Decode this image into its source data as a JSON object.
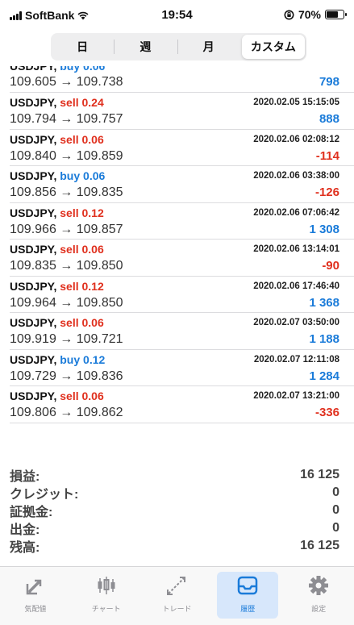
{
  "status": {
    "carrier": "SoftBank",
    "time": "19:54",
    "battery": "70%",
    "battery_level": 0.7
  },
  "periods": [
    {
      "label": "日",
      "active": false
    },
    {
      "label": "週",
      "active": false
    },
    {
      "label": "月",
      "active": false
    },
    {
      "label": "カスタム",
      "active": true
    }
  ],
  "deals": [
    {
      "symbol": "USDJPY,",
      "side": "buy",
      "volume": "0.06",
      "time": "",
      "prices": "109.605 → 109.738",
      "profit": "798",
      "partial": true
    },
    {
      "symbol": "USDJPY,",
      "side": "sell",
      "volume": "0.24",
      "time": "2020.02.05 15:15:05",
      "prices": "109.794 → 109.757",
      "profit": "888"
    },
    {
      "symbol": "USDJPY,",
      "side": "sell",
      "volume": "0.06",
      "time": "2020.02.06 02:08:12",
      "prices": "109.840 → 109.859",
      "profit": "-114"
    },
    {
      "symbol": "USDJPY,",
      "side": "buy",
      "volume": "0.06",
      "time": "2020.02.06 03:38:00",
      "prices": "109.856 → 109.835",
      "profit": "-126"
    },
    {
      "symbol": "USDJPY,",
      "side": "sell",
      "volume": "0.12",
      "time": "2020.02.06 07:06:42",
      "prices": "109.966 → 109.857",
      "profit": "1 308"
    },
    {
      "symbol": "USDJPY,",
      "side": "sell",
      "volume": "0.06",
      "time": "2020.02.06 13:14:01",
      "prices": "109.835 → 109.850",
      "profit": "-90"
    },
    {
      "symbol": "USDJPY,",
      "side": "sell",
      "volume": "0.12",
      "time": "2020.02.06 17:46:40",
      "prices": "109.964 → 109.850",
      "profit": "1 368"
    },
    {
      "symbol": "USDJPY,",
      "side": "sell",
      "volume": "0.06",
      "time": "2020.02.07 03:50:00",
      "prices": "109.919 → 109.721",
      "profit": "1 188"
    },
    {
      "symbol": "USDJPY,",
      "side": "buy",
      "volume": "0.12",
      "time": "2020.02.07 12:11:08",
      "prices": "109.729 → 109.836",
      "profit": "1 284"
    },
    {
      "symbol": "USDJPY,",
      "side": "sell",
      "volume": "0.06",
      "time": "2020.02.07 13:21:00",
      "prices": "109.806 → 109.862",
      "profit": "-336"
    }
  ],
  "summary": [
    {
      "label": "損益:",
      "value": "16 125"
    },
    {
      "label": "クレジット:",
      "value": "0"
    },
    {
      "label": "証拠金:",
      "value": "0"
    },
    {
      "label": "出金:",
      "value": "0"
    },
    {
      "label": "残高:",
      "value": "16 125"
    }
  ],
  "tabs": [
    {
      "label": "気配値",
      "icon": "quotes-icon",
      "active": false
    },
    {
      "label": "チャート",
      "icon": "chart-icon",
      "active": false
    },
    {
      "label": "トレード",
      "icon": "trade-icon",
      "active": false
    },
    {
      "label": "履歴",
      "icon": "history-icon",
      "active": true
    },
    {
      "label": "設定",
      "icon": "settings-icon",
      "active": false
    }
  ],
  "colors": {
    "buy": "#1a7bd9",
    "sell": "#e0301e",
    "active_tab_bg": "#d7e7fb"
  }
}
